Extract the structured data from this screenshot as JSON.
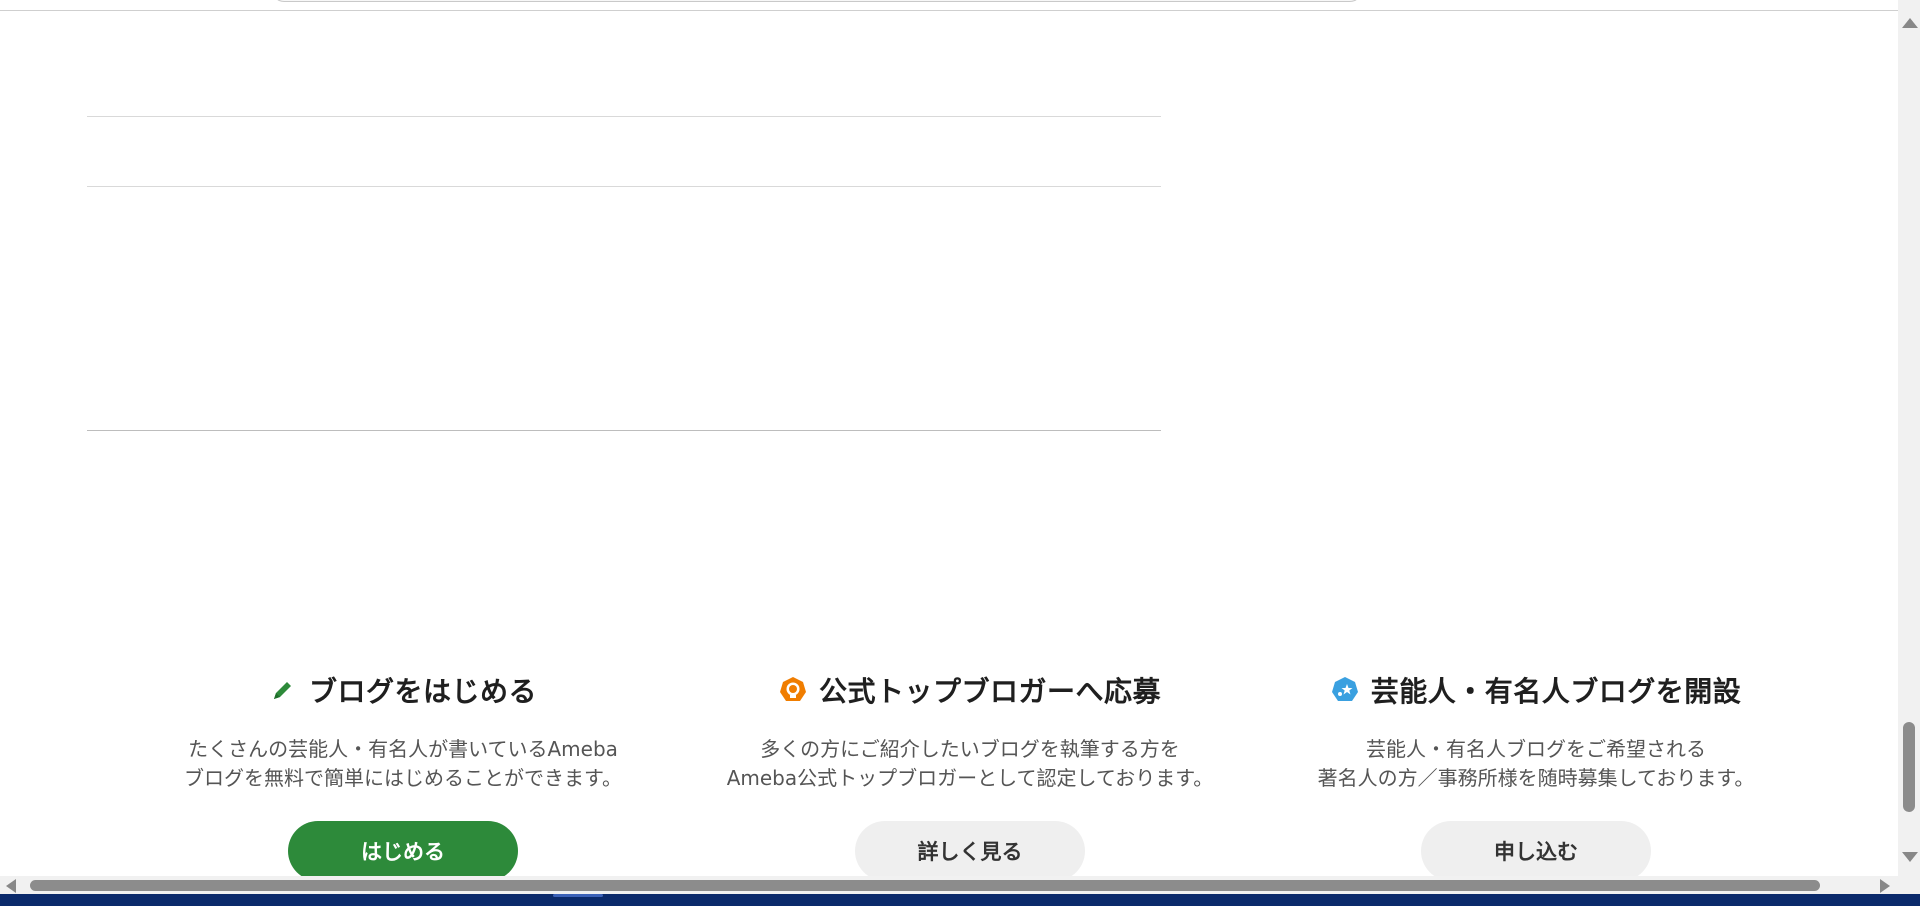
{
  "cta_section": {
    "columns": [
      {
        "icon": "pencil-icon",
        "icon_color": "#2d8a3a",
        "title": "ブログをはじめる",
        "desc_line1": "たくさんの芸能人・有名人が書いているAmeba",
        "desc_line2": "ブログを無料で簡単にはじめることができます。",
        "button_label": "はじめる",
        "button_style": "primary",
        "button_color": "#2d8a3a"
      },
      {
        "icon": "badge-icon",
        "icon_color": "#f07d00",
        "title": "公式トップブロガーへ応募",
        "desc_line1": "多くの方にご紹介したいブログを執筆する方を",
        "desc_line2": "Ameba公式トップブロガーとして認定しております。",
        "button_label": "詳しく見る",
        "button_style": "secondary"
      },
      {
        "icon": "star-badge-icon",
        "icon_color": "#3aa0e0",
        "title": "芸能人・有名人ブログを開設",
        "desc_line1": "芸能人・有名人ブログをご希望される",
        "desc_line2": "著名人の方／事務所様を随時募集しております。",
        "button_label": "申し込む",
        "button_style": "secondary"
      }
    ]
  },
  "colors": {
    "primary_green": "#2d8a3a",
    "secondary_button_bg": "#efefef",
    "taskbar": "#0b2a6b"
  }
}
